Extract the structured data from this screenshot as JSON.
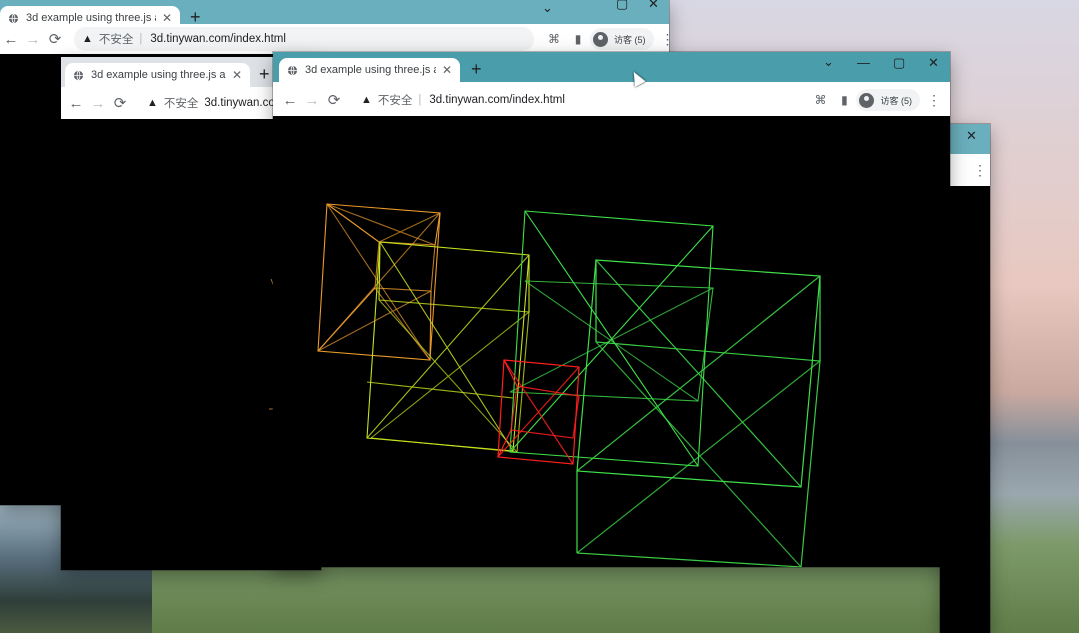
{
  "app": {
    "tab_title_full": "3d example using three.js and",
    "tab_title_short": "3d example using three.js and",
    "url": "3d.tinywan.com/index.html",
    "insecure_label": "不安全",
    "separator": "|",
    "profile_label": "访客 (5)"
  },
  "windows": {
    "back_top": {
      "tab_title": "3d example using three.js and",
      "new_tab": "+",
      "url_display": "3d.tinywan.com/index.html"
    },
    "middle": {
      "tab_title": "3d example using three.js and",
      "new_tab": "+",
      "url_display": "3d.tinywan.com/"
    },
    "front": {
      "tab_title": "3d example using three.js and",
      "new_tab": "+",
      "url_display": "3d.tinywan.com/index.html"
    }
  },
  "icons": {
    "back": "←",
    "forward": "→",
    "reload": "⟳",
    "warning": "▲",
    "translate": "⌘",
    "sidepanel": "▮",
    "menu": "⋮",
    "close": "✕",
    "minimize": "—",
    "maximize": "▢",
    "chevron": "⌄"
  },
  "colors": {
    "titlebar_active": "#4a9dab",
    "cube_orange": "#e99a2c",
    "cube_yellow": "#c8e21e",
    "cube_green": "#3fe04a",
    "cube_red": "#ff1f1f"
  }
}
